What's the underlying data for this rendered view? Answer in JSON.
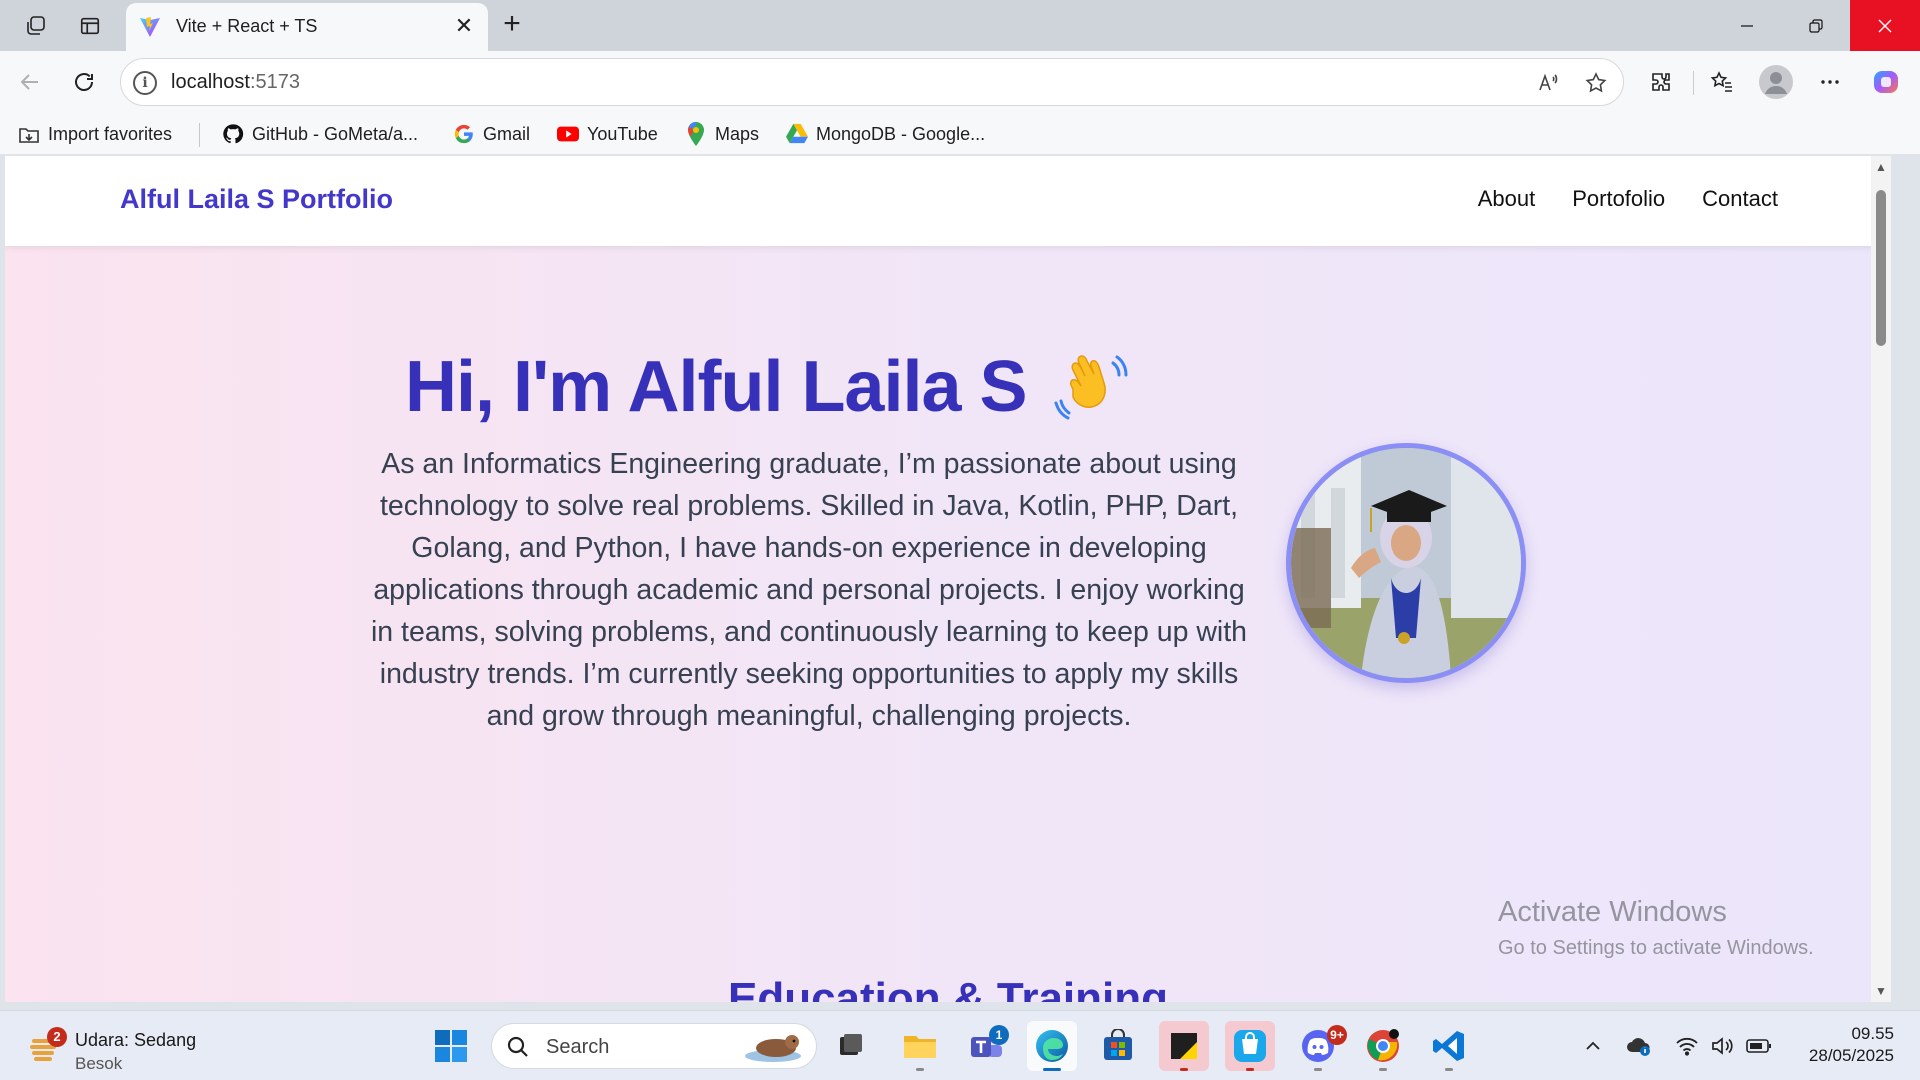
{
  "browser": {
    "tab_title": "Vite + React + TS",
    "url_host": "localhost",
    "url_port": ":5173",
    "favorites": [
      {
        "label": "Import favorites",
        "icon": "import-icon"
      },
      {
        "label": "GitHub - GoMeta/a...",
        "icon": "github-icon"
      },
      {
        "label": "Gmail",
        "icon": "google-icon"
      },
      {
        "label": "YouTube",
        "icon": "youtube-icon"
      },
      {
        "label": "Maps",
        "icon": "maps-icon"
      },
      {
        "label": "MongoDB - Google...",
        "icon": "drive-icon"
      }
    ]
  },
  "site": {
    "brand": "Alful Laila S Portfolio",
    "nav": [
      "About",
      "Portofolio",
      "Contact"
    ],
    "hero_title": "Hi, I'm Alful Laila S",
    "hero_text": "As an Informatics Engineering graduate, I’m passionate about using technology to solve real problems. Skilled in Java, Kotlin, PHP, Dart, Golang, and Python, I have hands-on experience in developing applications through academic and personal projects. I enjoy working in teams, solving problems, and continuously learning to keep up with industry trends. I’m currently seeking opportunities to apply my skills and grow through meaningful, challenging projects.",
    "next_section_title": "Education & Training",
    "accent_color": "#3730b8"
  },
  "watermark": {
    "line1": "Activate Windows",
    "line2": "Go to Settings to activate Windows."
  },
  "taskbar": {
    "weather_line1": "Udara: Sedang",
    "weather_line2": "Besok",
    "weather_badge": "2",
    "search_placeholder": "Search",
    "teams_badge": "1",
    "discord_badge": "9+",
    "time": "09.55",
    "date": "28/05/2025"
  }
}
